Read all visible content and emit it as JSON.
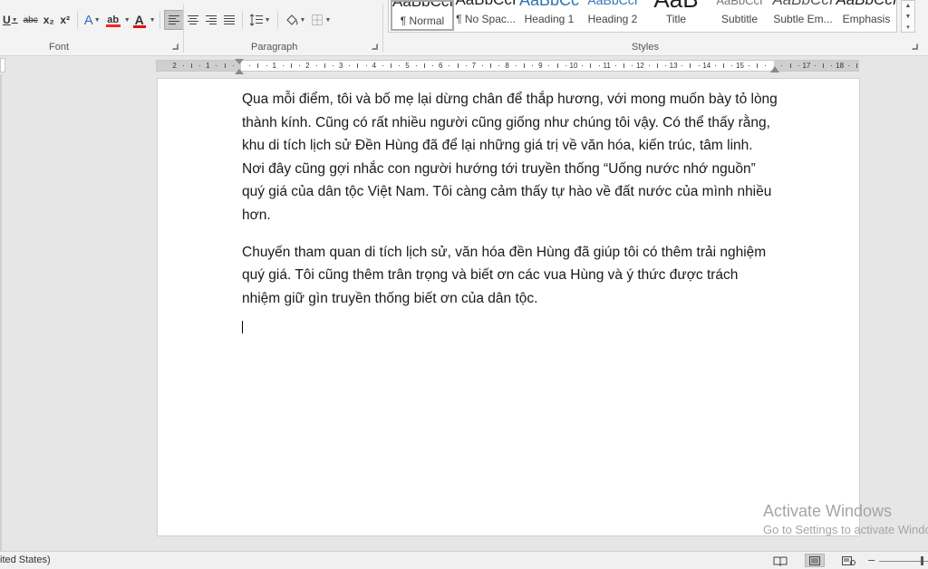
{
  "ribbon": {
    "font": {
      "label": "Font",
      "buttons": {
        "underline": "U",
        "strikethrough": "abc",
        "subscript": "x₂",
        "superscript": "x²",
        "text_effects": "A",
        "highlight": "ab",
        "font_color": "A"
      },
      "highlight_color": "#ff2020",
      "font_color_value": "#e01010"
    },
    "paragraph": {
      "label": "Paragraph"
    },
    "styles": {
      "label": "Styles",
      "items": [
        {
          "preview": "AaBbCcI",
          "label": "¶ Normal"
        },
        {
          "preview": "AaBbCcI",
          "label": "¶ No Spac..."
        },
        {
          "preview": "AaBbCc",
          "label": "Heading 1"
        },
        {
          "preview": "AaBbCcI",
          "label": "Heading 2"
        },
        {
          "preview": "AaB",
          "label": "Title"
        },
        {
          "preview": "AaBbCcI",
          "label": "Subtitle"
        },
        {
          "preview": "AaBbCcI",
          "label": "Subtle Em..."
        },
        {
          "preview": "AaBbCcI",
          "label": "Emphasis"
        }
      ],
      "heading_color": "#2e74b5"
    }
  },
  "ruler": {
    "labels": [
      "2",
      "1",
      "",
      "1",
      "2",
      "3",
      "4",
      "5",
      "6",
      "7",
      "8",
      "9",
      "10",
      "11",
      "12",
      "13",
      "14",
      "15",
      "",
      "17",
      "18"
    ]
  },
  "document": {
    "paragraphs": [
      "Qua mỗi điểm, tôi và bố mẹ lại dừng chân để thắp hương, với mong muốn bày tỏ lòng thành kính. Cũng có rất nhiều người cũng giống như chúng tôi vậy. Có thể thấy rằng, khu di tích lịch sử Đền Hùng đã để lại những giá trị về văn hóa, kiến trúc, tâm linh. Nơi đây cũng gợi nhắc con người hướng tới truyền thống “Uống nước nhớ nguồn” quý giá của dân tộc Việt Nam. Tôi càng cảm thấy tự hào về đất nước của mình nhiều hơn.",
      "Chuyến tham quan di tích lịch sử, văn hóa đền Hùng đã giúp tôi có thêm trải nghiệm quý giá. Tôi cũng thêm trân trọng và biết ơn các vua Hùng và ý thức được trách nhiệm giữ gìn truyền thống biết ơn của dân tộc."
    ]
  },
  "watermark": {
    "title": "Activate Windows",
    "subtitle": "Go to Settings to activate Windows."
  },
  "statusbar": {
    "language": "ited States)"
  }
}
